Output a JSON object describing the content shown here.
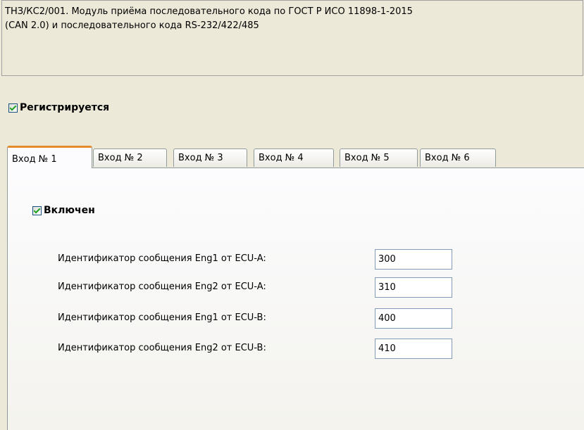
{
  "description": {
    "line1": "ТНЗ/КС2/001. Модуль приёма последовательного кода по ГОСТ Р ИСО 11898-1-2015",
    "line2": "(CAN 2.0) и последовательного кода RS-232/422/485"
  },
  "registered": {
    "label": "Регистрируется",
    "checked": true
  },
  "tabs": [
    {
      "label": "Вход № 1",
      "active": true
    },
    {
      "label": "Вход № 2",
      "active": false
    },
    {
      "label": "Вход № 3",
      "active": false
    },
    {
      "label": "Вход № 4",
      "active": false
    },
    {
      "label": "Вход № 5",
      "active": false
    },
    {
      "label": "Вход № 6",
      "active": false
    }
  ],
  "input_panel": {
    "enabled": {
      "label": "Включен",
      "checked": true
    },
    "fields": [
      {
        "label": "Идентификатор сообщения Eng1 от ECU-A:",
        "value": "300"
      },
      {
        "label": "Идентификатор сообщения Eng2 от ECU-A:",
        "value": "310"
      },
      {
        "label": "Идентификатор сообщения Eng1 от ECU-B:",
        "value": "400"
      },
      {
        "label": "Идентификатор сообщения Eng2 от ECU-B:",
        "value": "410"
      }
    ]
  }
}
